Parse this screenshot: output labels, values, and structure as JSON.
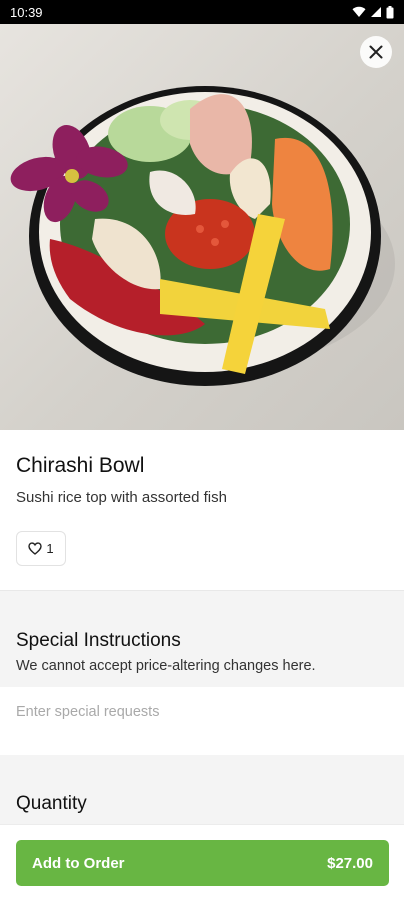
{
  "status_bar": {
    "time": "10:39"
  },
  "item": {
    "name": "Chirashi Bowl",
    "description": "Sushi rice top with assorted fish",
    "favorite_count": "1"
  },
  "special_instructions": {
    "title": "Special Instructions",
    "subtitle": "We cannot accept price-altering changes here.",
    "placeholder": "Enter special requests"
  },
  "quantity": {
    "title": "Quantity"
  },
  "add_to_order": {
    "label": "Add to Order",
    "price": "$27.00"
  },
  "colors": {
    "accent": "#68b643",
    "status_bar_bg": "#000000"
  },
  "icons": {
    "close": "close-icon",
    "heart": "heart-icon",
    "wifi": "wifi-icon",
    "signal": "signal-icon",
    "battery": "battery-icon"
  }
}
